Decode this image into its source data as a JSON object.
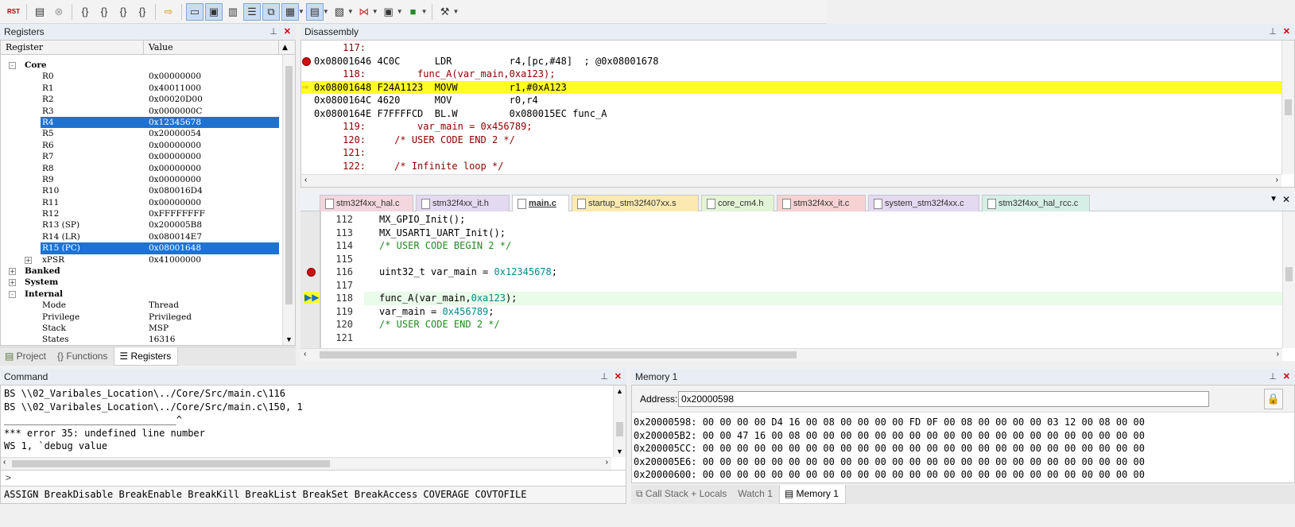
{
  "toolbar": {
    "buttons": [
      "rst-icon",
      "disassembly-icon",
      "stop-icon",
      "step-into-icon",
      "step-over-icon",
      "step-out-icon",
      "run-to-cursor-icon",
      "show-next-statement-icon",
      "command-window-icon",
      "disassembly-window-icon",
      "symbols-window-icon",
      "registers-window-icon",
      "call-stack-icon",
      "watch-window-icon",
      "memory-window-icon",
      "serial-window-icon",
      "analysis-window-icon",
      "trace-window-icon",
      "system-viewer-icon",
      "toolbox-icon"
    ],
    "rst_label": "RST"
  },
  "registers": {
    "title": "Registers",
    "col_register": "Register",
    "col_value": "Value",
    "rows": [
      {
        "name": "Core",
        "value": "",
        "level": 0,
        "toggle": "-"
      },
      {
        "name": "R0",
        "value": "0x00000000",
        "level": 2
      },
      {
        "name": "R1",
        "value": "0x40011000",
        "level": 2
      },
      {
        "name": "R2",
        "value": "0x00020D00",
        "level": 2
      },
      {
        "name": "R3",
        "value": "0x0000000C",
        "level": 2
      },
      {
        "name": "R4",
        "value": "0x12345678",
        "level": 2,
        "selected": true
      },
      {
        "name": "R5",
        "value": "0x20000054",
        "level": 2
      },
      {
        "name": "R6",
        "value": "0x00000000",
        "level": 2
      },
      {
        "name": "R7",
        "value": "0x00000000",
        "level": 2
      },
      {
        "name": "R8",
        "value": "0x00000000",
        "level": 2
      },
      {
        "name": "R9",
        "value": "0x00000000",
        "level": 2
      },
      {
        "name": "R10",
        "value": "0x080016D4",
        "level": 2
      },
      {
        "name": "R11",
        "value": "0x00000000",
        "level": 2
      },
      {
        "name": "R12",
        "value": "0xFFFFFFFF",
        "level": 2
      },
      {
        "name": "R13 (SP)",
        "value": "0x200005B8",
        "level": 2
      },
      {
        "name": "R14 (LR)",
        "value": "0x080014E7",
        "level": 2
      },
      {
        "name": "R15 (PC)",
        "value": "0x08001648",
        "level": 2,
        "selected": true
      },
      {
        "name": "xPSR",
        "value": "0x41000000",
        "level": 2,
        "toggle": "+"
      },
      {
        "name": "Banked",
        "value": "",
        "level": 0,
        "toggle": "+"
      },
      {
        "name": "System",
        "value": "",
        "level": 0,
        "toggle": "+"
      },
      {
        "name": "Internal",
        "value": "",
        "level": 0,
        "toggle": "-"
      },
      {
        "name": "Mode",
        "value": "Thread",
        "level": 2
      },
      {
        "name": "Privilege",
        "value": "Privileged",
        "level": 2
      },
      {
        "name": "Stack",
        "value": "MSP",
        "level": 2
      },
      {
        "name": "States",
        "value": "16316",
        "level": 2
      }
    ],
    "tabs": [
      "Project",
      "Functions",
      "Registers"
    ]
  },
  "disassembly": {
    "title": "Disassembly",
    "lines": [
      {
        "text": "     117:",
        "kind": "src"
      },
      {
        "text": "0x08001646 4C0C      LDR          r4,[pc,#48]  ; @0x08001678",
        "kind": "asm",
        "bp": true
      },
      {
        "text": "     118:         func_A(var_main,0xa123);",
        "kind": "src"
      },
      {
        "text": "0x08001648 F24A1123  MOVW         r1,#0xA123",
        "kind": "asm",
        "current": true
      },
      {
        "text": "0x0800164C 4620      MOV          r0,r4",
        "kind": "asm"
      },
      {
        "text": "0x0800164E F7FFFFCD  BL.W         0x080015EC func_A",
        "kind": "asm"
      },
      {
        "text": "     119:         var_main = 0x456789;",
        "kind": "src"
      },
      {
        "text": "     120:     /* USER CODE END 2 */",
        "kind": "src"
      },
      {
        "text": "     121:",
        "kind": "src"
      },
      {
        "text": "     122:     /* Infinite loop */",
        "kind": "src"
      }
    ]
  },
  "file_tabs": [
    {
      "label": "stm32f4xx_hal.c",
      "color": "#f3d6de"
    },
    {
      "label": "stm32f4xx_it.h",
      "color": "#e3d9f0"
    },
    {
      "label": "main.c",
      "color": "#ffffff",
      "active": true
    },
    {
      "label": "startup_stm32f407xx.s",
      "color": "#fbeab0"
    },
    {
      "label": "core_cm4.h",
      "color": "#e3f3d6"
    },
    {
      "label": "stm32f4xx_it.c",
      "color": "#f6d2d2"
    },
    {
      "label": "system_stm32f4xx.c",
      "color": "#e3d9f0"
    },
    {
      "label": "stm32f4xx_hal_rcc.c",
      "color": "#d6efe6"
    }
  ],
  "editor": {
    "lines": [
      {
        "num": "112",
        "parts": [
          {
            "t": "MX_GPIO_Init();",
            "c": ""
          }
        ]
      },
      {
        "num": "113",
        "parts": [
          {
            "t": "MX_USART1_UART_Init();",
            "c": ""
          }
        ]
      },
      {
        "num": "114",
        "parts": [
          {
            "t": "/* USER CODE BEGIN 2 */",
            "c": "cm"
          }
        ]
      },
      {
        "num": "115",
        "parts": []
      },
      {
        "num": "116",
        "parts": [
          {
            "t": "uint32_t var_main = ",
            "c": ""
          },
          {
            "t": "0x12345678",
            "c": "nm"
          },
          {
            "t": ";",
            "c": ""
          }
        ],
        "bp": true
      },
      {
        "num": "117",
        "parts": []
      },
      {
        "num": "118",
        "parts": [
          {
            "t": "func_A(var_main,",
            "c": ""
          },
          {
            "t": "0xa123",
            "c": "nm"
          },
          {
            "t": ");",
            "c": ""
          }
        ],
        "current": true
      },
      {
        "num": "119",
        "parts": [
          {
            "t": "var_main = ",
            "c": ""
          },
          {
            "t": "0x456789",
            "c": "nm"
          },
          {
            "t": ";",
            "c": ""
          }
        ]
      },
      {
        "num": "120",
        "parts": [
          {
            "t": "/* USER CODE END 2 */",
            "c": "cm"
          }
        ]
      },
      {
        "num": "121",
        "parts": []
      }
    ]
  },
  "command": {
    "title": "Command",
    "lines": [
      "BS \\\\02_Varibales_Location\\../Core/Src/main.c\\116",
      "BS \\\\02_Varibales_Location\\../Core/Src/main.c\\150, 1",
      "______________________________^",
      "*** error 35: undefined line number",
      "WS 1, `debug value"
    ],
    "prompt": ">",
    "hint": "ASSIGN BreakDisable BreakEnable BreakKill BreakList BreakSet BreakAccess COVERAGE COVTOFILE"
  },
  "memory": {
    "title": "Memory 1",
    "address_label": "Address:",
    "address_value": "0x20000598",
    "lines": [
      "0x20000598: 00 00 00 00 D4 16 00 08 00 00 00 00 FD 0F 00 08 00 00 00 00 03 12 00 08 00 00",
      "0x200005B2: 00 00 47 16 00 08 00 00 00 00 00 00 00 00 00 00 00 00 00 00 00 00 00 00 00 00",
      "0x200005CC: 00 00 00 00 00 00 00 00 00 00 00 00 00 00 00 00 00 00 00 00 00 00 00 00 00 00",
      "0x200005E6: 00 00 00 00 00 00 00 00 00 00 00 00 00 00 00 00 00 00 00 00 00 00 00 00 00 00",
      "0x20000600: 00 00 00 00 00 00 00 00 00 00 00 00 00 00 00 00 00 00 00 00 00 00 00 00 00 00"
    ],
    "tabs": [
      "Call Stack + Locals",
      "Watch 1",
      "Memory 1"
    ]
  }
}
